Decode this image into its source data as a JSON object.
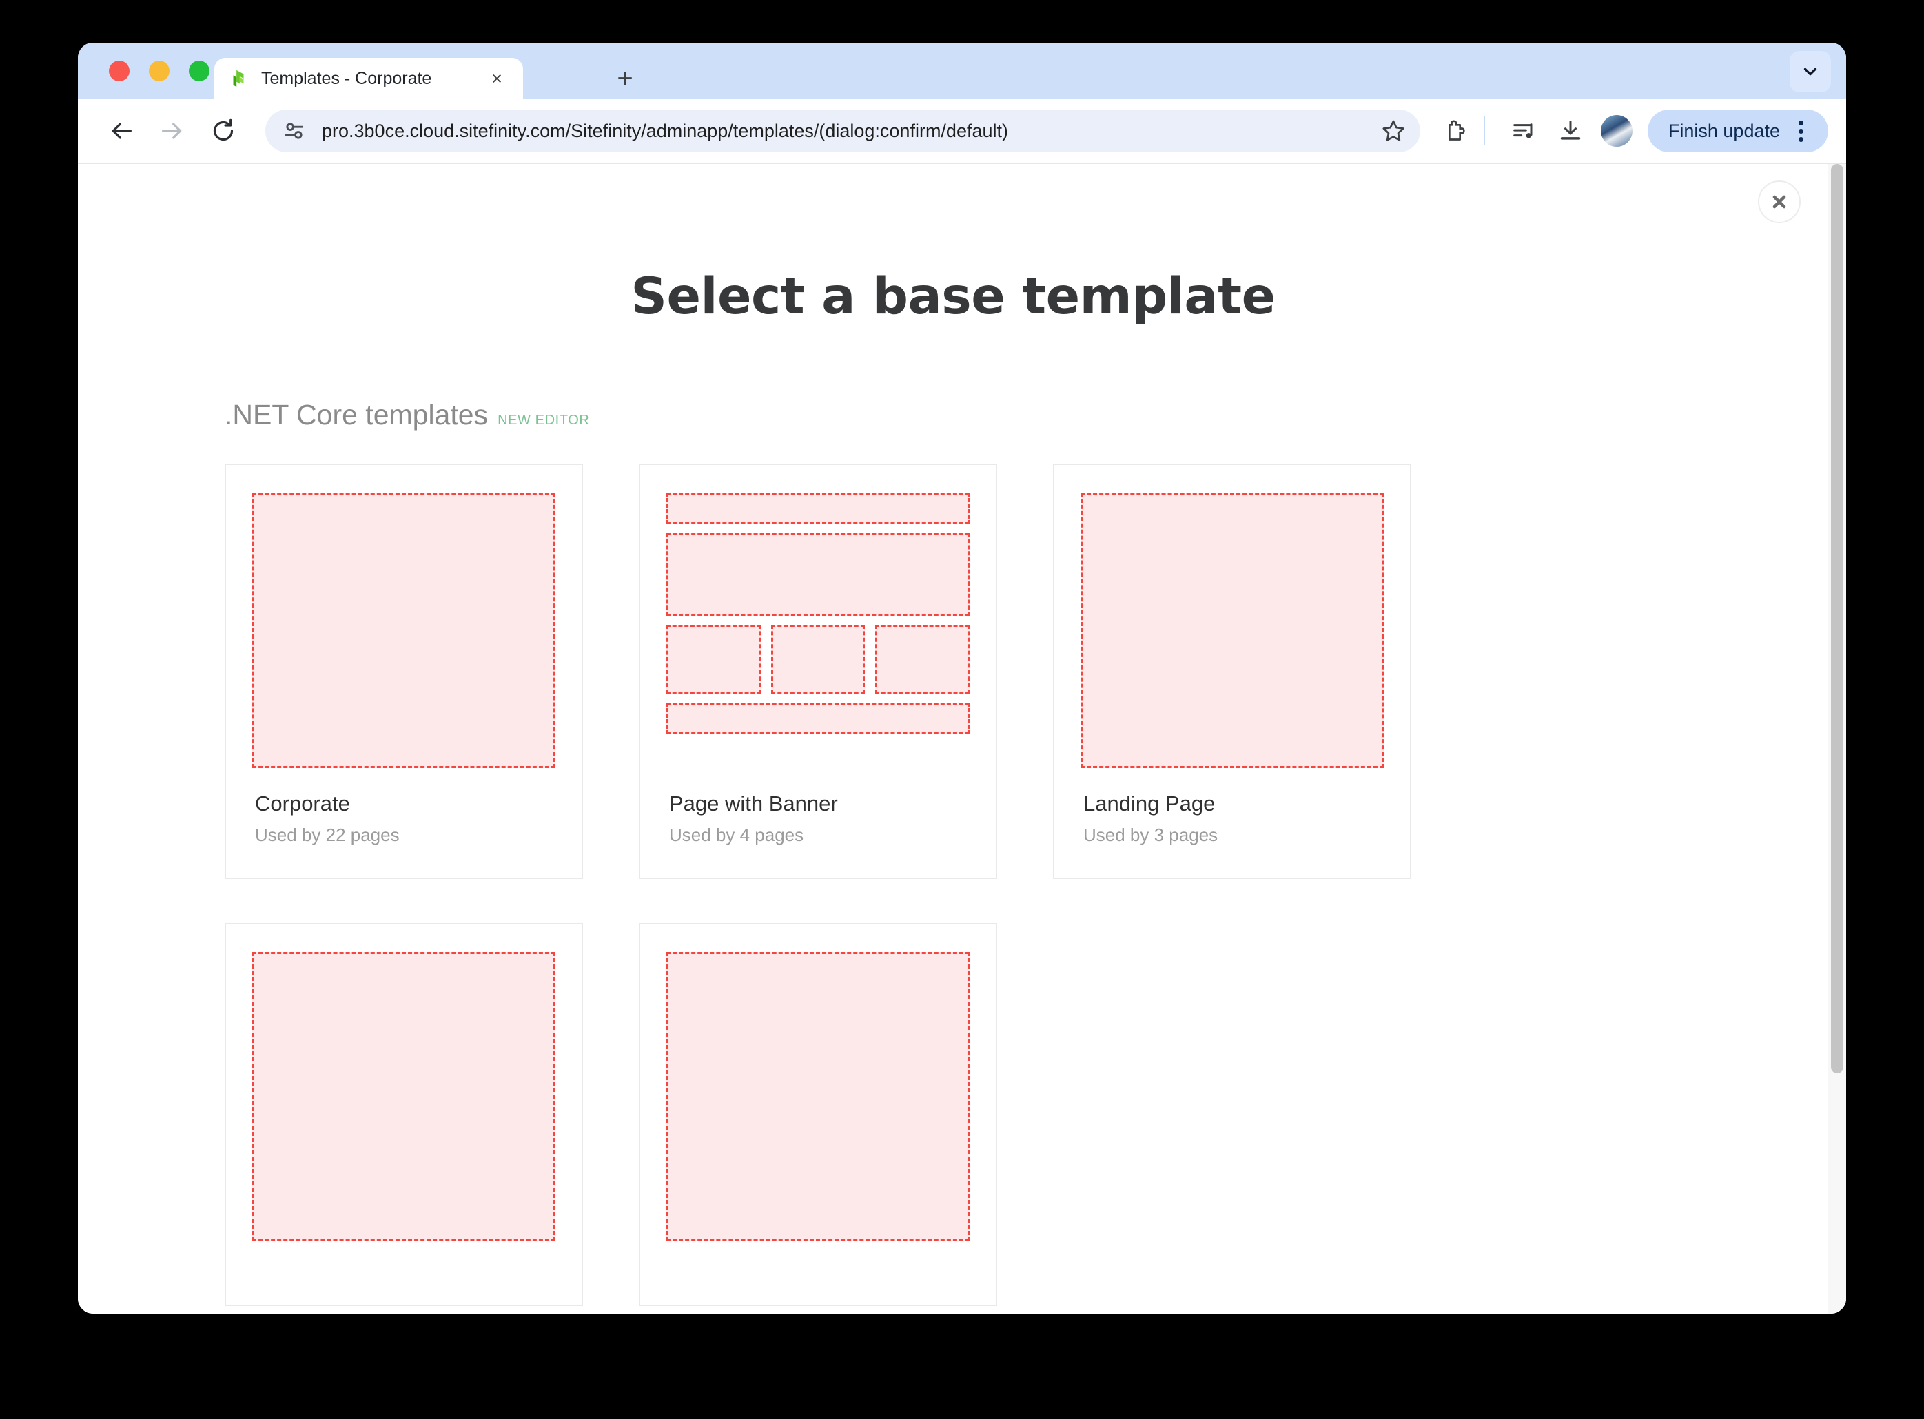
{
  "browser": {
    "tab": {
      "title": "Templates - Corporate",
      "favicon": "sitefinity-logo-icon",
      "close_label": "×"
    },
    "new_tab_label": "+",
    "toolbar": {
      "back_icon": "back-arrow-icon",
      "forward_icon": "forward-arrow-icon",
      "reload_icon": "reload-icon",
      "site_info_icon": "site-settings-icon",
      "url": "pro.3b0ce.cloud.sitefinity.com/Sitefinity/adminapp/templates/(dialog:confirm/default)",
      "bookmark_icon": "star-icon",
      "extensions_icon": "puzzle-piece-icon",
      "media_icon": "media-playlist-icon",
      "downloads_icon": "download-icon",
      "profile_icon": "avatar-icon",
      "finish_update_label": "Finish update",
      "menu_icon": "three-dot-menu-icon"
    },
    "tab_list_icon": "chevron-down-icon"
  },
  "dialog": {
    "close_icon": "close-icon",
    "title": "Select a base template",
    "section": {
      "title": ".NET Core templates",
      "badge": "NEW EDITOR"
    },
    "templates": [
      {
        "name": "Corporate",
        "usage": "Used by 22 pages",
        "preview": "single-region"
      },
      {
        "name": "Page with Banner",
        "usage": "Used by 4 pages",
        "preview": "banner-three-column"
      },
      {
        "name": "Landing Page",
        "usage": "Used by 3 pages",
        "preview": "single-region"
      },
      {
        "name": "",
        "usage": "",
        "preview": "single-region"
      },
      {
        "name": "",
        "usage": "",
        "preview": "single-region"
      }
    ]
  },
  "colors": {
    "placeholder_fill": "#fde9e9",
    "placeholder_border": "#f4453f",
    "badge_green": "#7ac292",
    "accent_blue": "#c9dcfa",
    "tab_strip": "#cedffa"
  }
}
